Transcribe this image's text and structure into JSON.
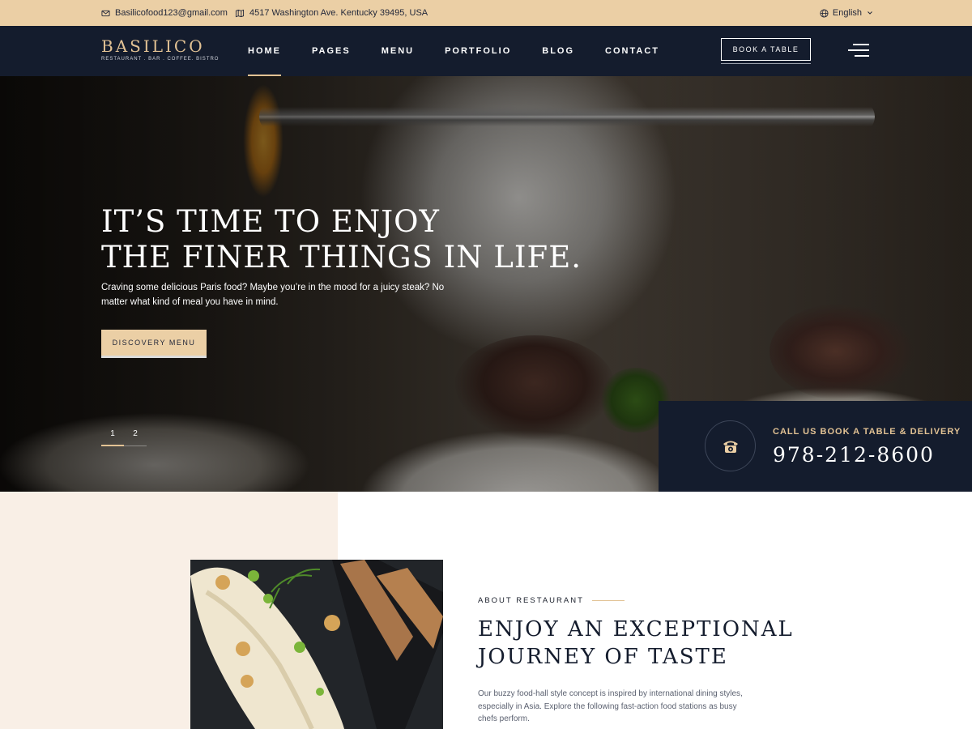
{
  "topbar": {
    "email": "Basilicofood123@gmail.com",
    "address": "4517 Washington Ave. Kentucky 39495, USA",
    "language": "English",
    "email_icon": "mail-icon",
    "address_icon": "map-icon",
    "language_icon": "globe-icon"
  },
  "brand": {
    "name": "BASILICO",
    "tagline": "RESTAURANT . BAR . COFFEE. BISTRO"
  },
  "nav": {
    "items": [
      {
        "label": "HOME",
        "active": true
      },
      {
        "label": "PAGES"
      },
      {
        "label": "MENU"
      },
      {
        "label": "PORTFOLIO"
      },
      {
        "label": "BLOG"
      },
      {
        "label": "CONTACT"
      }
    ],
    "book_button": "BOOK A TABLE"
  },
  "hero": {
    "title_line1": "IT’S TIME TO ENJOY",
    "title_line2": "THE FINER THINGS IN LIFE.",
    "text": "Craving some delicious Paris food? Maybe you’re in the mood for a juicy steak? No matter what kind of meal you have in mind.",
    "button": "DISCOVERY MENU",
    "slides": [
      "1",
      "2"
    ],
    "active_slide": 1
  },
  "call": {
    "label": "CALL US BOOK A TABLE & DELIVERY",
    "number": "978-212-8600",
    "icon": "phone-icon"
  },
  "about": {
    "kicker": "ABOUT RESTAURANT",
    "title_line1": "ENJOY AN EXCEPTIONAL",
    "title_line2": "JOURNEY OF TASTE",
    "text": "Our buzzy food-hall style concept is inspired by international dining styles, especially in Asia. Explore the following fast-action food stations as busy chefs perform."
  },
  "colors": {
    "accent": "#ebcfa5",
    "navy": "#141c2d",
    "cream": "#f9efe6"
  }
}
